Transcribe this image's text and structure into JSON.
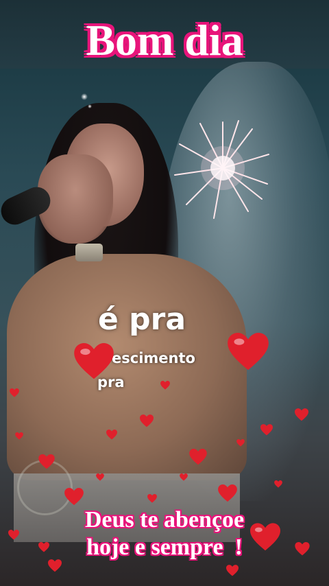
{
  "overlay": {
    "title": "Bom dia",
    "lyrics": {
      "main": "é pra",
      "line2": "escimento",
      "line3": "pra"
    },
    "blessing": {
      "line1": "Deus te abençoe",
      "line2": "hoje e sempre  !"
    }
  },
  "colors": {
    "title_outline": "#e8147a",
    "heart": "#e0202c"
  },
  "icons": [
    "heart-icon",
    "firework-icon",
    "microphone-icon"
  ]
}
